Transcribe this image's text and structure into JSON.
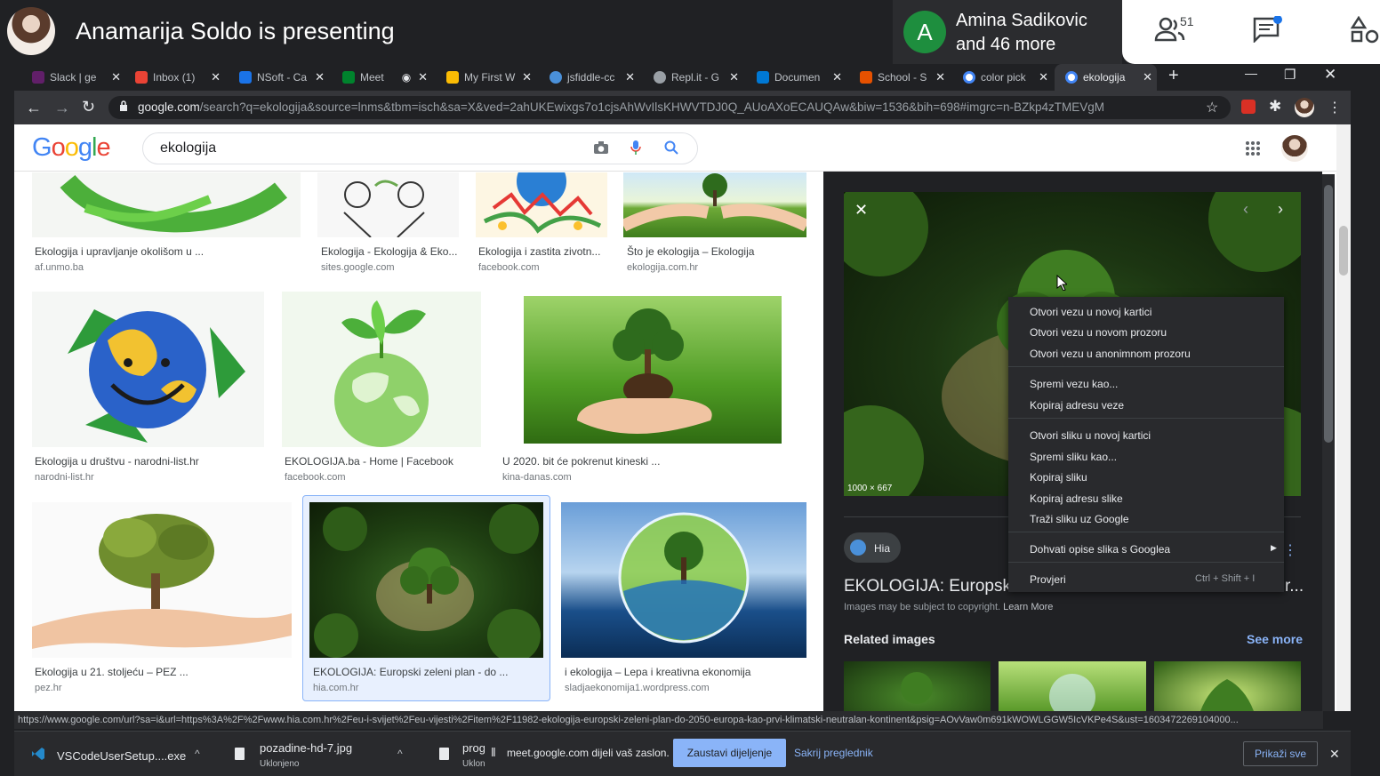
{
  "meet": {
    "presenting_text": "Anamarija Soldo is presenting",
    "participant_initial": "A",
    "participant_name_line1": "Amina Sadikovic",
    "participant_name_line2": "and 46 more",
    "participant_count": "51"
  },
  "browser": {
    "tabs": [
      {
        "label": "Slack | ge",
        "color": "#611f69"
      },
      {
        "label": "Inbox (1)",
        "color": "#ea4335"
      },
      {
        "label": "NSoft - Ca",
        "color": "#1a73e8"
      },
      {
        "label": "Meet",
        "color": "#00832d"
      },
      {
        "label": "My First W",
        "color": "#fbbc04"
      },
      {
        "label": "jsfiddle-cc",
        "color": "#4a90d9"
      },
      {
        "label": "Repl.it - G",
        "color": "#9aa0a6"
      },
      {
        "label": "Documen",
        "color": "#0078d4"
      },
      {
        "label": "School - S",
        "color": "#e65100"
      },
      {
        "label": "color pick",
        "color": "#4285f4"
      },
      {
        "label": "ekologija",
        "color": "#4285f4"
      }
    ],
    "url_host": "google.com",
    "url_path": "/search?q=ekologija&source=lnms&tbm=isch&sa=X&ved=2ahUKEwixgs7o1cjsAhWvIlsKHWVTDJ0Q_AUoAXoECAUQAw&biw=1536&bih=698#imgrc=n-BZkp4zTMEVgM"
  },
  "google": {
    "logo": "Google",
    "search_value": "ekologija",
    "results": [
      {
        "caption": "Ekologija i upravljanje okolišom u ...",
        "source": "af.unmo.ba"
      },
      {
        "caption": "Ekologija - Ekologija & Eko...",
        "source": "sites.google.com"
      },
      {
        "caption": "Ekologija i zastita zivotn...",
        "source": "facebook.com"
      },
      {
        "caption": "Što je ekologija – Ekologija",
        "source": "ekologija.com.hr"
      },
      {
        "caption": "Ekologija u društvu - narodni-list.hr",
        "source": "narodni-list.hr"
      },
      {
        "caption": "EKOLOGIJA.ba - Home | Facebook",
        "source": "facebook.com"
      },
      {
        "caption": "U 2020. bit će pokrenut kineski ...",
        "source": "kina-danas.com"
      },
      {
        "caption": "Ekologija u 21. stoljeću – PEZ ...",
        "source": "pez.hr"
      },
      {
        "caption": "EKOLOGIJA: Europski zeleni plan - do ...",
        "source": "hia.com.hr"
      },
      {
        "caption": "i ekologija – Lepa i kreativna ekonomija",
        "source": "sladjaekonomija1.wordpress.com"
      }
    ],
    "panel": {
      "dimensions": "1000 × 667",
      "site_name": "Hia",
      "title": "EKOLOGIJA: Europski",
      "title_suffix": "r...",
      "copyright": "Images may be subject to copyright.",
      "learn_more": "Learn More",
      "related_heading": "Related images",
      "see_more": "See more"
    }
  },
  "context_menu": {
    "items": [
      "Otvori vezu u novoj kartici",
      "Otvori vezu u novom prozoru",
      "Otvori vezu u anonimnom prozoru",
      "Spremi vezu kao...",
      "Kopiraj adresu veze",
      "Otvori sliku u novoj kartici",
      "Spremi sliku kao...",
      "Kopiraj sliku",
      "Kopiraj adresu slike",
      "Traži sliku uz Google",
      "Dohvati opise slika s Googlea",
      "Provjeri"
    ],
    "shortcut": "Ctrl + Shift + I"
  },
  "status_url": "https://www.google.com/url?sa=i&url=https%3A%2F%2Fwww.hia.com.hr%2Feu-i-svijet%2Feu-vijesti%2Fitem%2F11982-ekologija-europski-zeleni-plan-do-2050-europa-kao-prvi-klimatski-neutralan-kontinent&psig=AOvVaw0m691kWOWLGGW5IcVKPe4S&ust=1603472269104000...",
  "downloads": {
    "item1": "VSCodeUserSetup....exe",
    "item2_name": "pozadine-hd-7.jpg",
    "item2_sub": "Uklonjeno",
    "item3_name": "prog",
    "item3_sub": "Uklon",
    "share_text": "meet.google.com dijeli vaš zaslon.",
    "stop_label": "Zaustavi dijeljenje",
    "hide_label": "Sakrij preglednik",
    "show_all": "Prikaži sve"
  }
}
